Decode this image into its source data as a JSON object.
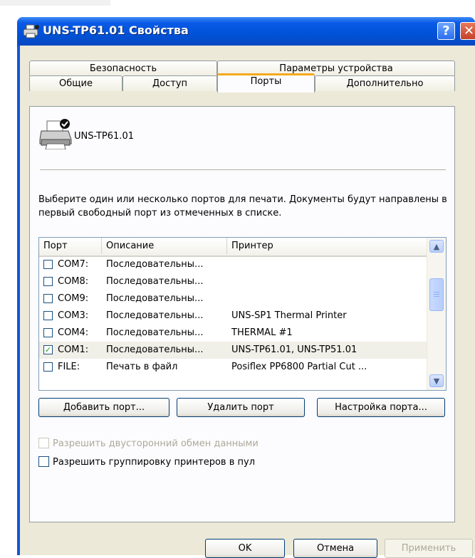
{
  "window": {
    "title": "UNS-TP61.01 Свойства",
    "help_glyph": "?",
    "close_glyph": "✕"
  },
  "tabs": {
    "row_back": [
      "Безопасность",
      "Параметры устройства"
    ],
    "row_front": [
      "Общие",
      "Доступ",
      "Порты",
      "Дополнительно"
    ],
    "active": "Порты"
  },
  "printer": {
    "name": "UNS-TP61.01",
    "icon": "printer-shared-icon"
  },
  "description": "Выберите один или несколько портов для печати. Документы будут направлены в первый свободный порт из отмеченных в списке.",
  "ports_list": {
    "columns": [
      "Порт",
      "Описание",
      "Принтер"
    ],
    "rows": [
      {
        "port": "COM7:",
        "description": "Последовательны...",
        "printer": "",
        "checked": false
      },
      {
        "port": "COM8:",
        "description": "Последовательны...",
        "printer": "",
        "checked": false
      },
      {
        "port": "COM9:",
        "description": "Последовательны...",
        "printer": "",
        "checked": false
      },
      {
        "port": "COM3:",
        "description": "Последовательны...",
        "printer": "UNS-SP1 Thermal Printer",
        "checked": false
      },
      {
        "port": "COM4:",
        "description": "Последовательны...",
        "printer": "THERMAL #1",
        "checked": false
      },
      {
        "port": "COM1:",
        "description": "Последовательны...",
        "printer": "UNS-TP61.01, UNS-TP51.01",
        "checked": true
      },
      {
        "port": "FILE:",
        "description": "Печать в файл",
        "printer": "Posiflex PP6800 Partial Cut ...",
        "checked": false
      }
    ],
    "selected_row": 5,
    "scroll_up_glyph": "▲",
    "scroll_down_glyph": "▼"
  },
  "port_buttons": {
    "add": "Добавить порт...",
    "delete": "Удалить порт",
    "configure": "Настройка порта..."
  },
  "options": {
    "bidirectional": "Разрешить двусторонний обмен данными",
    "pooling": "Разрешить группировку принтеров в пул"
  },
  "footer": {
    "ok": "OK",
    "cancel": "Отмена",
    "apply": "Применить"
  },
  "colors": {
    "titlebar": "#0052d8",
    "client": "#ece9d8",
    "active_tab_accent": "#f6a81c",
    "check": "#21a121"
  }
}
